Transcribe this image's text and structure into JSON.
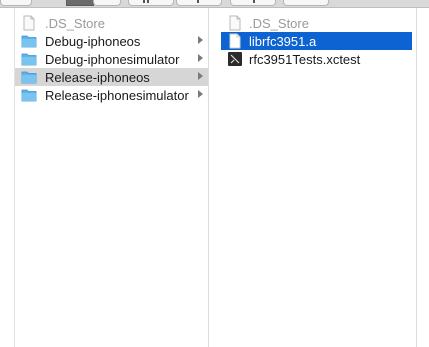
{
  "column1": {
    "items": [
      {
        "label": ".DS_Store",
        "icon": "document-icon"
      },
      {
        "label": "Debug-iphoneos",
        "icon": "folder-icon"
      },
      {
        "label": "Debug-iphonesimulator",
        "icon": "folder-icon"
      },
      {
        "label": "Release-iphoneos",
        "icon": "folder-icon"
      },
      {
        "label": "Release-iphonesimulator",
        "icon": "folder-icon"
      }
    ]
  },
  "column2": {
    "items": [
      {
        "label": ".DS_Store",
        "icon": "document-icon"
      },
      {
        "label": "librfc3951.a",
        "icon": "document-icon"
      },
      {
        "label": "rfc3951Tests.xctest",
        "icon": "executable-icon"
      }
    ]
  },
  "colors": {
    "selection_blue": "#0e63d2",
    "selection_gray": "#d6d6d6",
    "folder_blue": "#5bb3ec",
    "dim_text": "#9a9a9a"
  }
}
